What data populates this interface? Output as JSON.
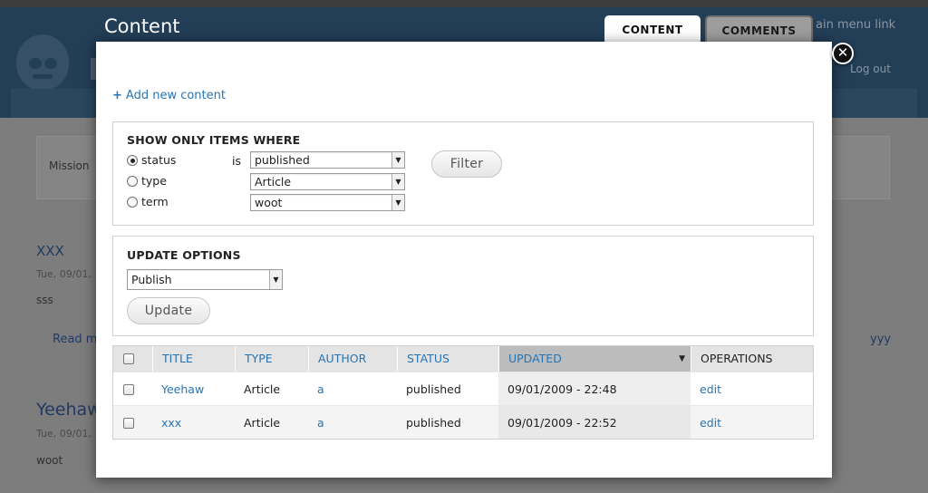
{
  "background": {
    "main_menu_link": "ain menu link",
    "log_out": "Log out",
    "mission_label": "Mission",
    "posts": [
      {
        "title": "XXX",
        "meta": "Tue, 09/01,",
        "body": "sss",
        "read_more": "Read m"
      },
      {
        "title": "Yeehaw",
        "meta": "Tue, 09/01,",
        "body": "woot"
      }
    ],
    "right_link": "yyy"
  },
  "page": {
    "title": "Content"
  },
  "tabs": [
    {
      "label": "CONTENT",
      "active": true
    },
    {
      "label": "COMMENTS",
      "active": false
    }
  ],
  "overlay": {
    "close_symbol": "✕",
    "add_new": {
      "plus": "+",
      "label": "Add new content"
    },
    "filter": {
      "legend": "SHOW ONLY ITEMS WHERE",
      "is_label": "is",
      "rows": [
        {
          "label": "status",
          "selected": true,
          "value": "published"
        },
        {
          "label": "type",
          "selected": false,
          "value": "Article"
        },
        {
          "label": "term",
          "selected": false,
          "value": "woot"
        }
      ],
      "button": "Filter"
    },
    "update": {
      "legend": "UPDATE OPTIONS",
      "value": "Publish",
      "button": "Update"
    },
    "table": {
      "headers": [
        "TITLE",
        "TYPE",
        "AUTHOR",
        "STATUS",
        "UPDATED",
        "OPERATIONS"
      ],
      "sorted_column": "UPDATED",
      "rows": [
        {
          "title": "Yeehaw",
          "type": "Article",
          "author": "a",
          "status": "published",
          "updated": "09/01/2009 - 22:48",
          "op": "edit"
        },
        {
          "title": "xxx",
          "type": "Article",
          "author": "a",
          "status": "published",
          "updated": "09/01/2009 - 22:52",
          "op": "edit"
        }
      ]
    }
  },
  "colors": {
    "link": "#2774b5",
    "header_bg": "#233e57",
    "sorted_header": "#bcbcbc"
  }
}
